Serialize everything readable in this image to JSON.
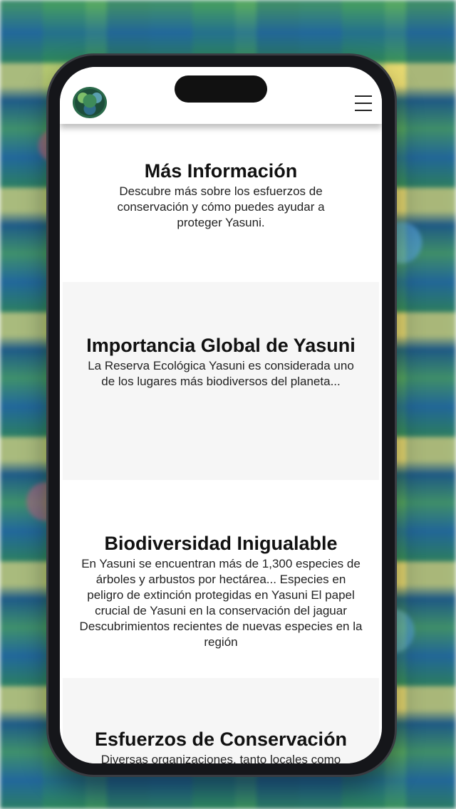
{
  "header": {
    "logo_icon": "yasuni-logo-icon",
    "menu_icon": "hamburger-menu-icon"
  },
  "sections": [
    {
      "title": "Más Información",
      "text": "Descubre más sobre los esfuerzos de conservación y cómo puedes ayudar a proteger Yasuni."
    },
    {
      "title": "Importancia Global de Yasuni",
      "text": "La Reserva Ecológica Yasuni es considerada uno de los lugares más biodiversos del planeta..."
    },
    {
      "title": "Biodiversidad Inigualable",
      "text": "En Yasuni se encuentran más de 1,300 especies de árboles y arbustos por hectárea... Especies en peligro de extinción protegidas en Yasuni El papel crucial de Yasuni en la conservación del jaguar Descubrimientos recientes de nuevas especies en la región"
    },
    {
      "title": "Esfuerzos de Conservación",
      "text": "Diversas organizaciones, tanto locales como"
    }
  ]
}
